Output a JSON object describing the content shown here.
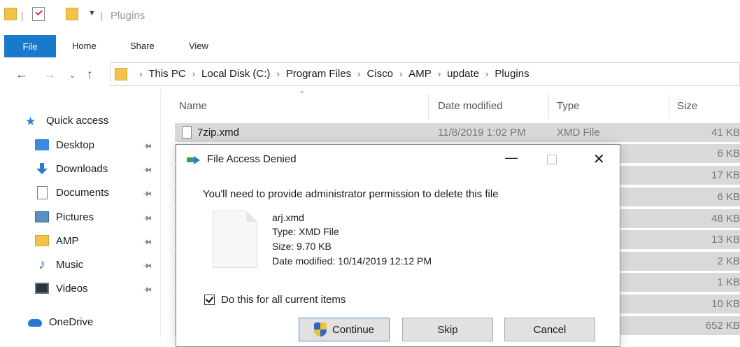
{
  "window": {
    "title": "Plugins"
  },
  "ribbon": {
    "tabs": [
      "File",
      "Home",
      "Share",
      "View"
    ]
  },
  "address": {
    "path": [
      "This PC",
      "Local Disk (C:)",
      "Program Files",
      "Cisco",
      "AMP",
      "update",
      "Plugins"
    ]
  },
  "nav": {
    "quick_access": "Quick access",
    "items": [
      "Desktop",
      "Downloads",
      "Documents",
      "Pictures",
      "AMP",
      "Music",
      "Videos"
    ],
    "onedrive": "OneDrive"
  },
  "columns": {
    "name": "Name",
    "date": "Date modified",
    "type": "Type",
    "size": "Size"
  },
  "files": [
    {
      "name": "7zip.xmd",
      "date": "11/8/2019 1:02 PM",
      "type": "XMD File",
      "size": "41 KB"
    },
    {
      "size": "6 KB"
    },
    {
      "size": "17 KB"
    },
    {
      "size": "6 KB"
    },
    {
      "size": "48 KB"
    },
    {
      "size": "13 KB"
    },
    {
      "size": "2 KB"
    },
    {
      "size": "1 KB"
    },
    {
      "size": "10 KB"
    },
    {
      "size": "652 KB"
    }
  ],
  "dialog": {
    "title": "File Access Denied",
    "message": "You'll need to provide administrator permission to delete this file",
    "file": {
      "name": "arj.xmd",
      "type": "Type: XMD File",
      "size": "Size: 9.70 KB",
      "modified": "Date modified: 10/14/2019 12:12 PM"
    },
    "checkbox": {
      "label": "Do this for all current items",
      "checked": true
    },
    "buttons": {
      "continue": "Continue",
      "skip": "Skip",
      "cancel": "Cancel"
    }
  },
  "colors": {
    "accent": "#1979ca",
    "selection": "#d9d9d9"
  }
}
